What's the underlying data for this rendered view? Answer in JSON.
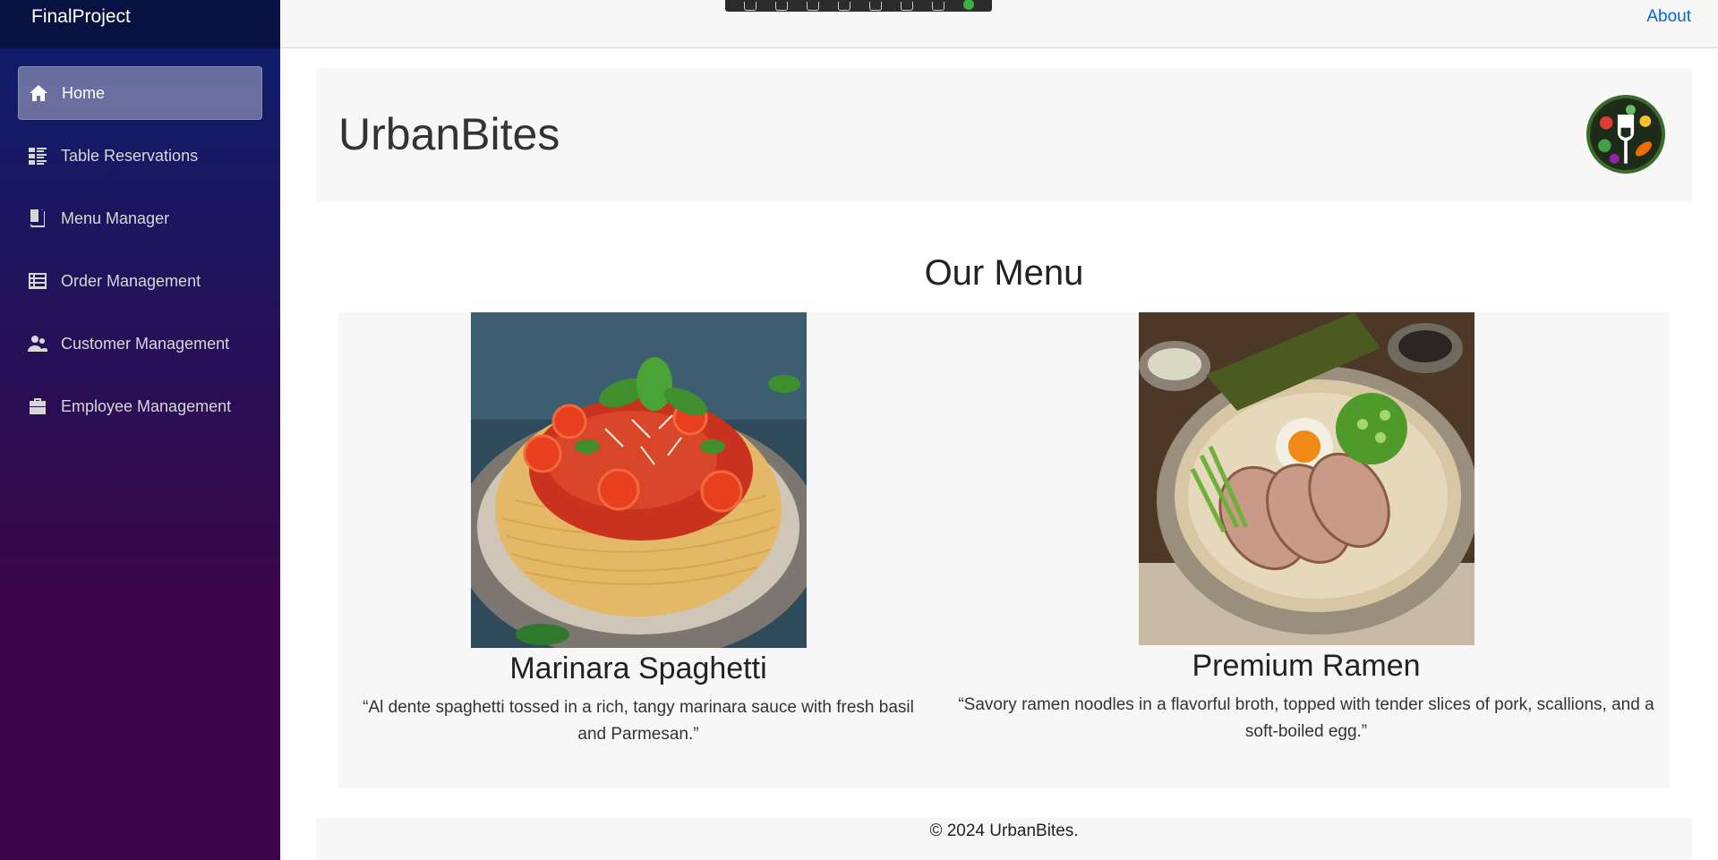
{
  "app": {
    "brand": "FinalProject"
  },
  "topbar": {
    "about_label": "About"
  },
  "sidebar": {
    "items": [
      {
        "label": "Home",
        "icon": "home-icon",
        "active": true
      },
      {
        "label": "Table Reservations",
        "icon": "table-list-icon",
        "active": false
      },
      {
        "label": "Menu Manager",
        "icon": "book-icon",
        "active": false
      },
      {
        "label": "Order Management",
        "icon": "list-icon",
        "active": false
      },
      {
        "label": "Customer Management",
        "icon": "people-icon",
        "active": false
      },
      {
        "label": "Employee Management",
        "icon": "briefcase-icon",
        "active": false
      }
    ]
  },
  "hero": {
    "title": "UrbanBites"
  },
  "menu": {
    "heading": "Our Menu",
    "items": [
      {
        "name": "Marinara Spaghetti",
        "description": "“Al dente spaghetti tossed in a rich, tangy marinara sauce with fresh basil and Parmesan.”"
      },
      {
        "name": "Premium Ramen",
        "description": "“Savory ramen noodles in a flavorful broth, topped with tender slices of pork, scallions, and a soft-boiled egg.”"
      }
    ]
  },
  "footer": {
    "text": "© 2024 UrbanBites."
  },
  "colors": {
    "sidebar_top": "#0b1f6e",
    "sidebar_bottom": "#3a0647",
    "link": "#0366d6",
    "panel_bg": "#f7f7f7"
  }
}
